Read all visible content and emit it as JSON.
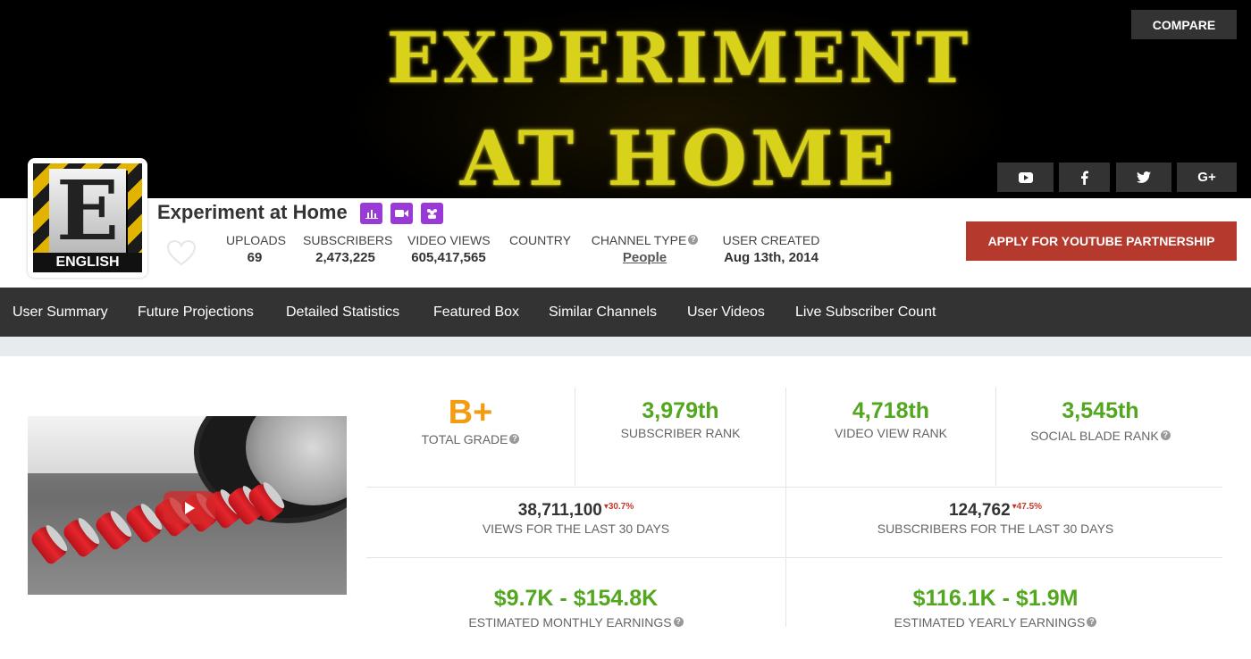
{
  "banner": {
    "line1": "EXPERIMENT",
    "line2": "AT HOME",
    "compare_label": "COMPARE",
    "social_icons": [
      "youtube-icon",
      "facebook-icon",
      "twitter-icon",
      "google-plus-icon"
    ],
    "gplus_label": "G+"
  },
  "avatar": {
    "letter": "E",
    "language_label": "ENGLISH"
  },
  "channel": {
    "name": "Experiment at Home",
    "badges": [
      "chart-icon",
      "video-camera-icon",
      "group-icon"
    ]
  },
  "stats": {
    "uploads": {
      "label": "UPLOADS",
      "value": "69"
    },
    "subscribers": {
      "label": "SUBSCRIBERS",
      "value": "2,473,225"
    },
    "video_views": {
      "label": "VIDEO VIEWS",
      "value": "605,417,565"
    },
    "country": {
      "label": "COUNTRY",
      "value": ""
    },
    "channel_type": {
      "label": "CHANNEL TYPE",
      "value": "People"
    },
    "user_created": {
      "label": "USER CREATED",
      "value": "Aug 13th, 2014"
    }
  },
  "apply_label": "APPLY FOR YOUTUBE PARTNERSHIP",
  "nav": {
    "items": [
      "User Summary",
      "Future Projections",
      "Detailed Statistics",
      "Featured Box",
      "Similar Channels",
      "User Videos",
      "Live Subscriber Count"
    ]
  },
  "summary": {
    "total_grade": {
      "value": "B+",
      "label": "TOTAL GRADE"
    },
    "subscriber_rank": {
      "value": "3,979th",
      "label": "SUBSCRIBER RANK"
    },
    "video_view_rank": {
      "value": "4,718th",
      "label": "VIDEO VIEW RANK"
    },
    "social_blade_rank": {
      "value": "3,545th",
      "label": "SOCIAL BLADE RANK"
    },
    "views_30": {
      "value": "38,711,100",
      "delta": "30.7%",
      "label": "VIEWS FOR THE LAST 30 DAYS"
    },
    "subs_30": {
      "value": "124,762",
      "delta": "47.5%",
      "label": "SUBSCRIBERS FOR THE LAST 30 DAYS"
    },
    "monthly_earnings": {
      "value": "$9.7K - $154.8K",
      "label": "ESTIMATED MONTHLY EARNINGS"
    },
    "yearly_earnings": {
      "value": "$116.1K - $1.9M",
      "label": "ESTIMATED YEARLY EARNINGS"
    }
  },
  "colors": {
    "accent_green": "#52a71f",
    "grade_orange": "#f29c12",
    "apply_red": "#b53a2d",
    "badge_purple": "#9a3ad6",
    "delta_red": "#c7392b",
    "nav_dark": "#333333"
  }
}
